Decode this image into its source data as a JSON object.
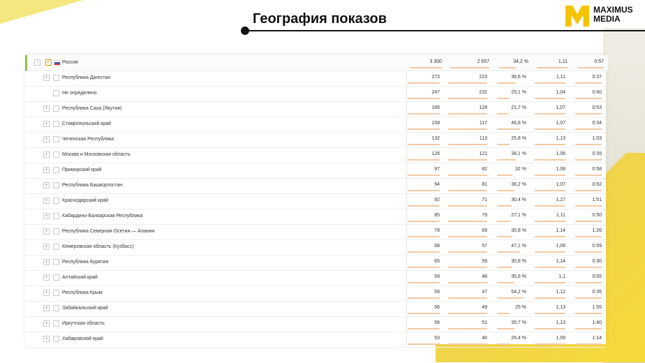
{
  "header": {
    "title": "География показов"
  },
  "logo": {
    "line1": "MAXIMUS",
    "line2": "MEDIA",
    "color": "#f5c400"
  },
  "colors": {
    "accent_bar": "#f2c9a4",
    "selected_border": "#8bc34a",
    "background_accent": "#f6d93a"
  },
  "table": {
    "rows": [
      {
        "name": "Россия",
        "v1": "3 300",
        "v2": "2 657",
        "v3": "34,2 %",
        "v4": "1,11",
        "v5": "0:57"
      },
      {
        "name": "Республика Дагестан",
        "v1": "273",
        "v2": "223",
        "v3": "36,6 %",
        "v4": "1,11",
        "v5": "0:37"
      },
      {
        "name": "Не определено",
        "v1": "247",
        "v2": "232",
        "v3": "25,1 %",
        "v4": "1,04",
        "v5": "0:40"
      },
      {
        "name": "Республика Саха (Якутия)",
        "v1": "166",
        "v2": "128",
        "v3": "21,7 %",
        "v4": "1,07",
        "v5": "0:53"
      },
      {
        "name": "Ставропольский край",
        "v1": "158",
        "v2": "117",
        "v3": "46,8 %",
        "v4": "1,07",
        "v5": "0:34"
      },
      {
        "name": "Чеченская Республика",
        "v1": "132",
        "v2": "113",
        "v3": "25,8 %",
        "v4": "1,13",
        "v5": "1:03"
      },
      {
        "name": "Москва и Московская область",
        "v1": "126",
        "v2": "121",
        "v3": "38,1 %",
        "v4": "1,06",
        "v5": "0:35"
      },
      {
        "name": "Приморский край",
        "v1": "97",
        "v2": "82",
        "v3": "32 %",
        "v4": "1,08",
        "v5": "0:58"
      },
      {
        "name": "Республика Башкортостан",
        "v1": "94",
        "v2": "81",
        "v3": "36,2 %",
        "v4": "1,07",
        "v5": "0:52"
      },
      {
        "name": "Краснодарский край",
        "v1": "92",
        "v2": "71",
        "v3": "30,4 %",
        "v4": "1,27",
        "v5": "1:51"
      },
      {
        "name": "Кабардино-Балкарская Республика",
        "v1": "85",
        "v2": "79",
        "v3": "27,1 %",
        "v4": "1,11",
        "v5": "0:50"
      },
      {
        "name": "Республика Северная Осетия — Алания",
        "v1": "78",
        "v2": "69",
        "v3": "30,8 %",
        "v4": "1,14",
        "v5": "1:26"
      },
      {
        "name": "Кемеровская область (Кузбасс)",
        "v1": "68",
        "v2": "57",
        "v3": "47,1 %",
        "v4": "1,09",
        "v5": "0:59"
      },
      {
        "name": "Республика Бурятия",
        "v1": "65",
        "v2": "59",
        "v3": "30,8 %",
        "v4": "1,14",
        "v5": "0:30"
      },
      {
        "name": "Алтайский край",
        "v1": "59",
        "v2": "48",
        "v3": "35,6 %",
        "v4": "1,1",
        "v5": "0:55"
      },
      {
        "name": "Республика Крым",
        "v1": "59",
        "v2": "47",
        "v3": "54,2 %",
        "v4": "1,12",
        "v5": "0:35"
      },
      {
        "name": "Забайкальский край",
        "v1": "56",
        "v2": "49",
        "v3": "25 %",
        "v4": "1,13",
        "v5": "1:55"
      },
      {
        "name": "Иркутская область",
        "v1": "56",
        "v2": "51",
        "v3": "35,7 %",
        "v4": "1,13",
        "v5": "1:40"
      },
      {
        "name": "Хабаровский край",
        "v1": "53",
        "v2": "46",
        "v3": "26,4 %",
        "v4": "1,09",
        "v5": "1:14"
      }
    ]
  }
}
